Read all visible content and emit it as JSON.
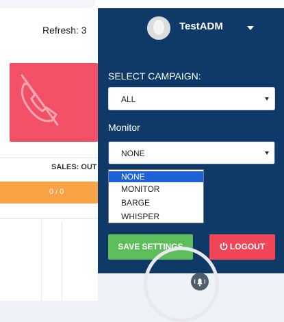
{
  "header": {
    "refresh_label": "Refresh: 3",
    "username": "TestADM"
  },
  "left_panel": {
    "sales_label": "SALES: OUT",
    "orange_value": "0 / 0"
  },
  "settings_panel": {
    "campaign_label": "SELECT CAMPAIGN:",
    "campaign_value": "ALL",
    "monitor_label": "Monitor",
    "monitor_value": "NONE",
    "monitor_options": [
      "NONE",
      "MONITOR",
      "BARGE",
      "WHISPER"
    ],
    "save_label": "SAVE SETTINGS",
    "logout_label": "LOGOUT"
  },
  "colors": {
    "navy": "#0f3a68",
    "red_card": "#f25067",
    "orange": "#f8a446",
    "green": "#5cbd5a",
    "logout_red": "#f04658",
    "dropdown_highlight": "#1e63d6"
  }
}
